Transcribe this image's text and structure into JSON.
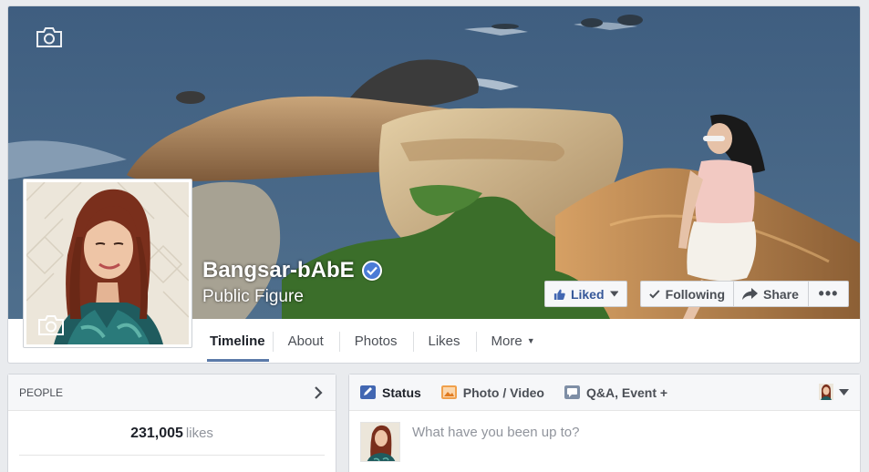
{
  "page": {
    "name": "Bangsar-bAbE",
    "category": "Public Figure",
    "verified": true
  },
  "cover_actions": {
    "liked_label": "Liked",
    "following_label": "Following",
    "share_label": "Share",
    "more_label": "•••"
  },
  "nav": {
    "tabs": [
      {
        "label": "Timeline",
        "active": true
      },
      {
        "label": "About"
      },
      {
        "label": "Photos"
      },
      {
        "label": "Likes"
      },
      {
        "label": "More"
      }
    ]
  },
  "people": {
    "heading": "PEOPLE",
    "likes_count": "231,005",
    "likes_label": "likes"
  },
  "composer": {
    "tabs": [
      {
        "label": "Status",
        "icon": "pencil-icon"
      },
      {
        "label": "Photo / Video",
        "icon": "photo-icon"
      },
      {
        "label": "Q&A, Event +",
        "icon": "speech-bubble-icon"
      }
    ],
    "placeholder": "What have you been up to?"
  },
  "colors": {
    "brand_blue": "#4267b2",
    "link_blue": "#365899",
    "verified_blue": "#4b7bd6",
    "tab_underline": "#5b7aa9",
    "background": "#e9ebee"
  }
}
